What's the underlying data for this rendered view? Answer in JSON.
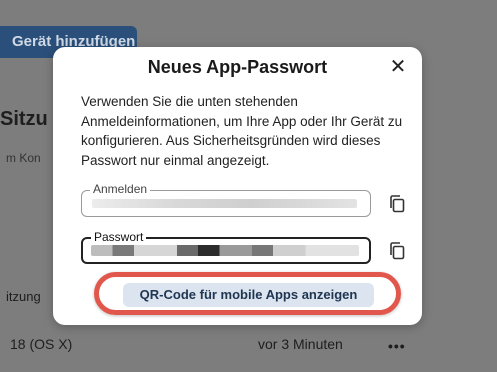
{
  "background": {
    "add_device_button": "Gerät hinzufügen",
    "section_title": "Sitzu",
    "section_subtitle": "m Kon",
    "row1_text": "itzung",
    "row2_device": "18 (OS X)",
    "row2_time": "vor 3 Minuten",
    "row2_menu": "•••"
  },
  "dialog": {
    "title": "Neues App-Passwort",
    "close_glyph": "✕",
    "description": "Verwenden Sie die unten stehenden Anmeldeinformationen, um Ihre App oder Ihr Gerät zu konfigurieren. Aus Sicherheitsgründen wird dieses Passwort nur einmal angezeigt.",
    "login_label": "Anmelden",
    "password_label": "Passwort",
    "copy_icon": "copy-icon",
    "qr_button": "QR-Code für mobile Apps anzeigen"
  },
  "colors": {
    "highlight": "#e2574c",
    "primary_button_bg": "#2a4f7a",
    "secondary_button_bg": "#dbe4ef"
  }
}
